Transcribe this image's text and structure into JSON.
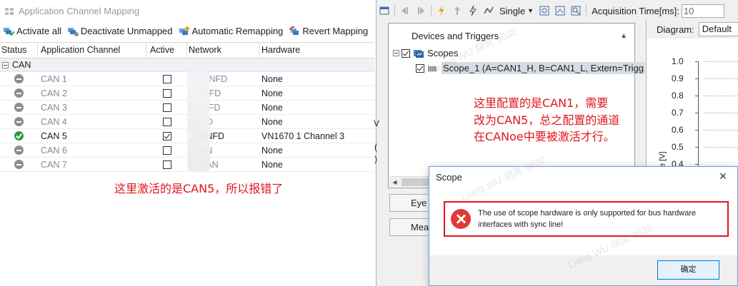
{
  "channel_mapping": {
    "title": "Application Channel Mapping",
    "toolbar": [
      {
        "label": "Activate all",
        "icon": "activate-all-icon"
      },
      {
        "label": "Deactivate Unmapped",
        "icon": "deactivate-unmapped-icon"
      },
      {
        "label": "Automatic Remapping",
        "icon": "automatic-remapping-icon"
      },
      {
        "label": "Revert Mapping",
        "icon": "revert-mapping-icon"
      }
    ],
    "columns": [
      "Status",
      "Application Channel",
      "Active",
      "Network",
      "Hardware"
    ],
    "group": "CAN",
    "rows": [
      {
        "channel": "CAN 1",
        "network": "F    CANFD",
        "hardware": "None",
        "active": false,
        "status": "inactive"
      },
      {
        "channel": "CAN 2",
        "network": "E    ANFD",
        "hardware": "None",
        "active": false,
        "status": "inactive"
      },
      {
        "channel": "CAN 3",
        "network": "F    ANFD",
        "hardware": "None",
        "active": false,
        "status": "inactive"
      },
      {
        "channel": "CAN 4",
        "network": "    ANFD",
        "hardware": "None",
        "active": false,
        "status": "inactive"
      },
      {
        "channel": "CAN 5",
        "network": "    _CANFD",
        "hardware": "VN1670 1 Channel 3",
        "active": true,
        "status": "active"
      },
      {
        "channel": "CAN 6",
        "network": "    _CAN",
        "hardware": "None",
        "active": false,
        "status": "inactive"
      },
      {
        "channel": "CAN 7",
        "network": "    X_CAN",
        "hardware": "None",
        "active": false,
        "status": "inactive"
      }
    ],
    "annotation": "这里激活的是CAN5，所以报错了"
  },
  "scope": {
    "trigger_mode": "Single",
    "acquisition_label": "Acquisition Time[ms]:",
    "acquisition_value": "10",
    "devices_title": "Devices and Triggers",
    "tree_root": "Scopes",
    "tree_child": "Scope_1 (A=CAN1_H, B=CAN1_L, Extern=Trigg",
    "annotation_lines": [
      "这里配置的是CAN1，需要",
      "改为CAN5，总之配置的通道",
      "在CANoe中要被激活才行。"
    ],
    "side_buttons": [
      "Eye",
      "Meas"
    ],
    "diagram_label": "Diagram:",
    "diagram_value": "Default",
    "y_label": "Voltage [V]",
    "y_ticks": [
      "1.0",
      "0.9",
      "0.8",
      "0.7",
      "0.6",
      "0.5",
      "0.4"
    ],
    "left_edge_glyphs": [
      "V",
      "(",
      ")"
    ]
  },
  "dialog": {
    "title": "Scope",
    "close": "×",
    "message": "The use of scope hardware is only supported for bus hardware interfaces with sync line!",
    "ok": "确定"
  },
  "watermarks": [
    "Liang WU 胡亮 9632",
    "Liang WU 胡亮 9632",
    "Liang WU 胡亮 9632"
  ],
  "colors": {
    "annotation": "#e0161e",
    "active_status": "#2e9d3c",
    "inactive_status": "#8d8d8d",
    "error_icon": "#e33838",
    "selection": "#d7dbe2"
  }
}
